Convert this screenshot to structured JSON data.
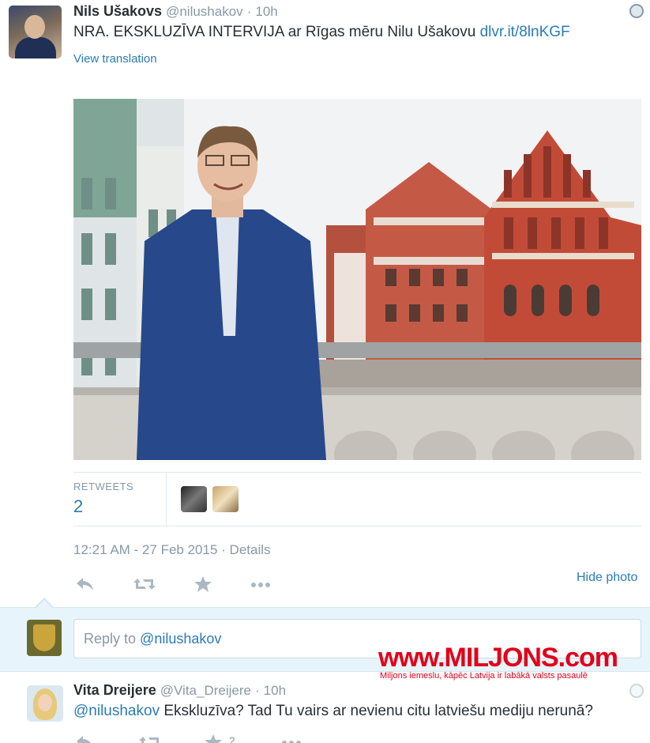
{
  "tweet": {
    "author_name": "Nils Ušakovs",
    "author_handle": "@nilushakov",
    "time_ago": "10h",
    "text": "NRA. EKSKLUZĪVA INTERVIJA ar Rīgas mēru Nilu Ušakovu",
    "link": "dlvr.it/8lnKGF",
    "view_translation": "View translation",
    "retweets_label": "RETWEETS",
    "retweets_count": "2",
    "timestamp": "12:21 AM - 27 Feb 2015",
    "details": "Details",
    "hide_photo": "Hide photo"
  },
  "reply_box": {
    "prefix": "Reply to ",
    "mention": "@nilushakov"
  },
  "watermark": {
    "main": "www.MILJONS.com",
    "sub": "Miljons iemeslu, kāpēc Latvija ir labākā valsts pasaulē"
  },
  "reply_tweet": {
    "author_name": "Vita Dreijere",
    "author_handle": "@Vita_Dreijere",
    "time_ago": "10h",
    "mention": "@nilushakov",
    "text": " Ekskluzīva? Tad Tu vairs ar nevienu citu latviešu mediju nerunā?",
    "favorites_count": "2"
  },
  "separator": "·",
  "icons": {
    "reply": "reply-icon",
    "retweet": "retweet-icon",
    "favorite": "star-icon",
    "more": "more-icon",
    "globe": "globe-icon"
  },
  "colors": {
    "link": "#2b7bb9",
    "muted": "#8899a6",
    "text": "#292f33",
    "reply_bg": "#e8f4fb",
    "watermark": "#e2001a"
  }
}
